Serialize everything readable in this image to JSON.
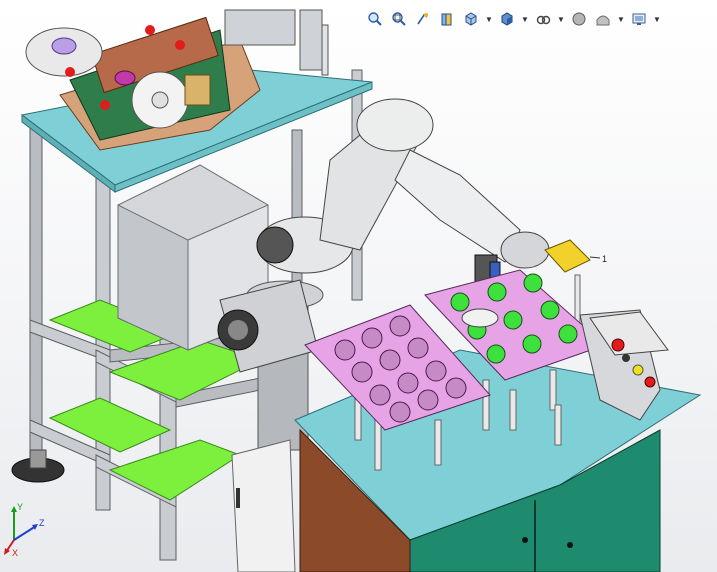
{
  "app": {
    "name": "SOLIDWORKS graphics area"
  },
  "hud_toolbar": {
    "tools": [
      {
        "name": "zoom-to-fit-icon",
        "has_dropdown": false
      },
      {
        "name": "zoom-to-area-icon",
        "has_dropdown": false
      },
      {
        "name": "previous-view-icon",
        "has_dropdown": false
      },
      {
        "name": "section-view-icon",
        "has_dropdown": false
      },
      {
        "name": "view-orientation-icon",
        "has_dropdown": true
      },
      {
        "name": "display-style-icon",
        "has_dropdown": true
      },
      {
        "name": "hide-show-items-icon",
        "has_dropdown": true
      },
      {
        "name": "edit-appearance-icon",
        "has_dropdown": false
      },
      {
        "name": "apply-scene-icon",
        "has_dropdown": true
      },
      {
        "name": "view-settings-icon",
        "has_dropdown": true
      }
    ]
  },
  "triad": {
    "x_label": "X",
    "y_label": "Y",
    "z_label": "Z"
  },
  "callout": {
    "label": "1"
  },
  "colors": {
    "frame_teal": "#7fd0d6",
    "frame_grey": "#c9ccd0",
    "panel_green": "#7cf03c",
    "cabinet_green": "#1e8a6e",
    "tray_pink": "#e6a4e6",
    "robot_white": "#e8e9ea",
    "door_brown": "#8b4a2a"
  }
}
